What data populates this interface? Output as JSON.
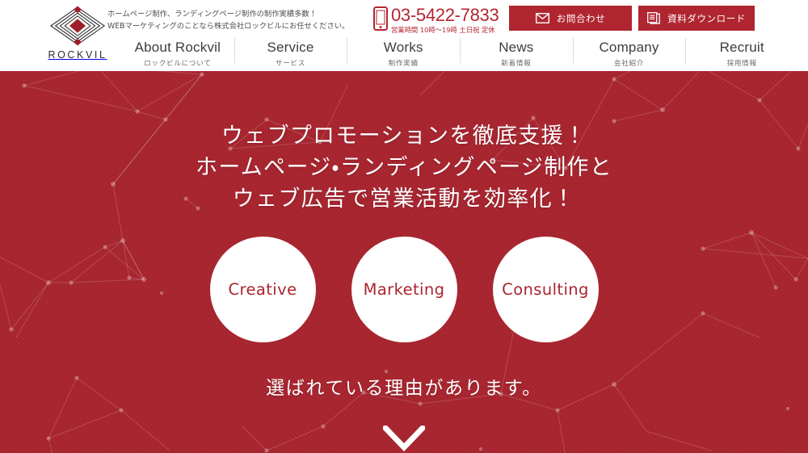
{
  "header": {
    "logo": {
      "wordmark": "ROCKVIL",
      "mark_icon": "diamond-layers-logo-icon"
    },
    "tagline_line1": "ホームページ制作、ランディングページ制作の制作実績多数！",
    "tagline_line2": "WEBマーケティングのことなら株式会社ロックビルにお任せください。",
    "phone": {
      "icon": "smartphone-icon",
      "number": "03-5422-7833",
      "hours": "営業時間 10時〜19時 土日祝 定休"
    },
    "buttons": [
      {
        "label": "お問合わせ",
        "icon": "envelope-icon"
      },
      {
        "label": "資料ダウンロード",
        "icon": "document-stack-icon"
      }
    ]
  },
  "nav": {
    "items": [
      {
        "en": "About Rockvil",
        "jp": "ロックビルについて"
      },
      {
        "en": "Service",
        "jp": "サービス"
      },
      {
        "en": "Works",
        "jp": "制作実績"
      },
      {
        "en": "News",
        "jp": "新着情報"
      },
      {
        "en": "Company",
        "jp": "会社紹介"
      },
      {
        "en": "Recruit",
        "jp": "採用情報"
      }
    ]
  },
  "hero": {
    "headline_line1": "ウェブプロモーションを徹底支援！",
    "headline_line2": "ホームページ・ランディングページ制作と",
    "headline_line3": "ウェブ広告で営業活動を効率化！",
    "circles": [
      {
        "label": "Creative"
      },
      {
        "label": "Marketing"
      },
      {
        "label": "Consulting"
      }
    ],
    "subline": "選ばれている理由があります。",
    "scroll_icon": "chevron-down-icon"
  },
  "colors": {
    "brand_red": "#a8252f",
    "button_red": "#b02630",
    "phone_red": "#b5252f",
    "header_bg": "#ffffff",
    "nav_text": "#3d3d3d",
    "nav_sub_text": "#6b6b6b",
    "circle_bg": "#ffffff"
  }
}
